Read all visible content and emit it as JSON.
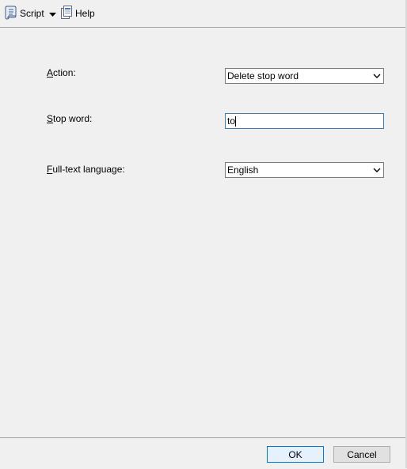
{
  "toolbar": {
    "script_label": "Script",
    "help_label": "Help",
    "script_icon": "script-icon",
    "dropdown_icon": "chevron-down-icon",
    "help_icon": "help-icon"
  },
  "form": {
    "action": {
      "label_access_key": "A",
      "label_rest": "ction:",
      "selected": "Delete stop word"
    },
    "stop_word": {
      "label_access_key": "S",
      "label_rest": "top word:",
      "value": "to"
    },
    "language": {
      "label_access_key": "F",
      "label_rest": "ull-text language:",
      "selected": "English"
    }
  },
  "footer": {
    "ok_label": "OK",
    "cancel_label": "Cancel"
  },
  "colors": {
    "background": "#f0f0f0",
    "focus_border": "#0078d7"
  }
}
